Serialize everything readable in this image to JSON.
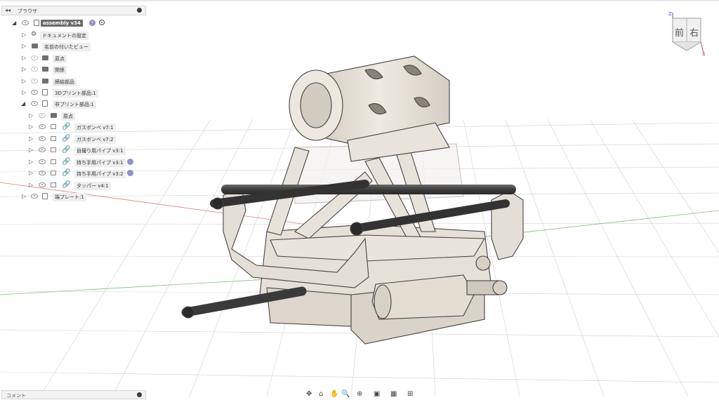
{
  "browser": {
    "title": "ブラウザ",
    "collapse_icon": "double-chevron-left-icon",
    "items": [
      {
        "label": "assembly v34",
        "level": 0,
        "type": "root"
      },
      {
        "label": "ドキュメントの設定",
        "level": 1,
        "type": "settings"
      },
      {
        "label": "名前の付いたビュー",
        "level": 1,
        "type": "folder"
      },
      {
        "label": "原点",
        "level": 1,
        "type": "folder"
      },
      {
        "label": "関係",
        "level": 1,
        "type": "folder"
      },
      {
        "label": "締結部品",
        "level": 1,
        "type": "folder"
      },
      {
        "label": "3Dプリント部品:1",
        "level": 1,
        "type": "component"
      },
      {
        "label": "非プリント部品:1",
        "level": 1,
        "type": "component"
      },
      {
        "label": "原点",
        "level": 2,
        "type": "folder"
      },
      {
        "label": "ガスボンベ v7:1",
        "level": 2,
        "type": "link"
      },
      {
        "label": "ガスボンベ v7:2",
        "level": 2,
        "type": "link"
      },
      {
        "label": "自撮り用パイプ v3:1",
        "level": 2,
        "type": "link"
      },
      {
        "label": "持ち手用パイプ v3:1",
        "level": 2,
        "type": "link"
      },
      {
        "label": "持ち手用パイプ v3:2",
        "level": 2,
        "type": "link"
      },
      {
        "label": "タッパー v4:1",
        "level": 2,
        "type": "link"
      },
      {
        "label": "端プレート:1",
        "level": 1,
        "type": "component"
      }
    ]
  },
  "viewcube": {
    "front": "前",
    "right": "右",
    "axis_z": "Z",
    "axis_x": "X"
  },
  "comments": {
    "label": "コメント"
  },
  "navbar": {
    "icons": [
      "orbit-icon",
      "look-at-icon",
      "pan-icon",
      "zoom-icon",
      "fit-icon",
      "display-mode-icon",
      "grid-icon",
      "viewports-icon"
    ]
  }
}
